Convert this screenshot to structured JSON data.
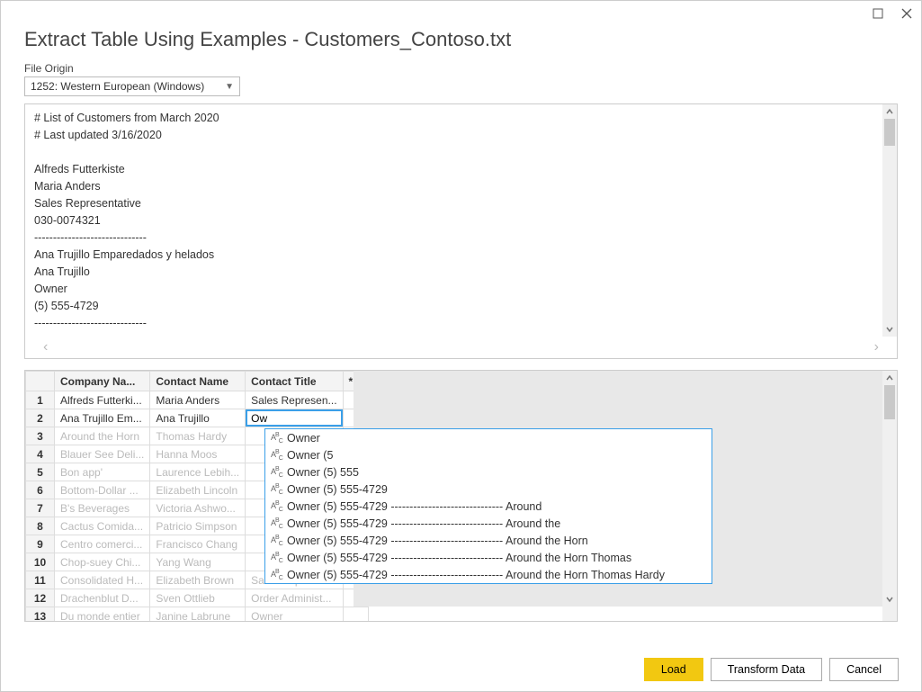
{
  "window": {
    "title": "Extract Table Using Examples - Customers_Contoso.txt"
  },
  "file_origin": {
    "label": "File Origin",
    "value": "1252: Western European (Windows)"
  },
  "preview_text": "# List of Customers from March 2020\n# Last updated 3/16/2020\n\nAlfreds Futterkiste\nMaria Anders\nSales Representative\n030-0074321\n------------------------------\nAna Trujillo Emparedados y helados\nAna Trujillo\nOwner\n(5) 555-4729\n------------------------------",
  "grid": {
    "headers": {
      "row": "",
      "company": "Company Na...",
      "contact": "Contact Name",
      "title": "Contact Title",
      "star": "*"
    },
    "editing_value": "Ow",
    "rows": [
      {
        "n": "1",
        "company": "Alfreds Futterki...",
        "contact": "Maria Anders",
        "title": "Sales Represen...",
        "suggested": false
      },
      {
        "n": "2",
        "company": "Ana Trujillo Em...",
        "contact": "Ana Trujillo",
        "title": "",
        "suggested": false,
        "editing": true
      },
      {
        "n": "3",
        "company": "Around the Horn",
        "contact": "Thomas Hardy",
        "title": "",
        "suggested": true
      },
      {
        "n": "4",
        "company": "Blauer See Deli...",
        "contact": "Hanna Moos",
        "title": "",
        "suggested": true
      },
      {
        "n": "5",
        "company": "Bon app'",
        "contact": "Laurence Lebih...",
        "title": "",
        "suggested": true
      },
      {
        "n": "6",
        "company": "Bottom-Dollar ...",
        "contact": "Elizabeth Lincoln",
        "title": "",
        "suggested": true
      },
      {
        "n": "7",
        "company": "B's Beverages",
        "contact": "Victoria Ashwo...",
        "title": "",
        "suggested": true
      },
      {
        "n": "8",
        "company": "Cactus Comida...",
        "contact": "Patricio Simpson",
        "title": "",
        "suggested": true
      },
      {
        "n": "9",
        "company": "Centro comerci...",
        "contact": "Francisco Chang",
        "title": "",
        "suggested": true
      },
      {
        "n": "10",
        "company": "Chop-suey Chi...",
        "contact": "Yang Wang",
        "title": "",
        "suggested": true
      },
      {
        "n": "11",
        "company": "Consolidated H...",
        "contact": "Elizabeth Brown",
        "title": "Sales Represen...",
        "suggested": true
      },
      {
        "n": "12",
        "company": "Drachenblut D...",
        "contact": "Sven Ottlieb",
        "title": "Order Administ...",
        "suggested": true
      },
      {
        "n": "13",
        "company": "Du monde entier",
        "contact": "Janine Labrune",
        "title": "Owner",
        "suggested": true
      }
    ]
  },
  "autocomplete": {
    "icon": "ABC",
    "items": [
      "Owner",
      "Owner (5",
      "Owner (5) 555",
      "Owner (5) 555-4729",
      "Owner (5) 555-4729 ------------------------------ Around",
      "Owner (5) 555-4729 ------------------------------ Around the",
      "Owner (5) 555-4729 ------------------------------ Around the Horn",
      "Owner (5) 555-4729 ------------------------------ Around the Horn Thomas",
      "Owner (5) 555-4729 ------------------------------ Around the Horn Thomas Hardy"
    ]
  },
  "footer": {
    "load": "Load",
    "transform": "Transform Data",
    "cancel": "Cancel"
  }
}
